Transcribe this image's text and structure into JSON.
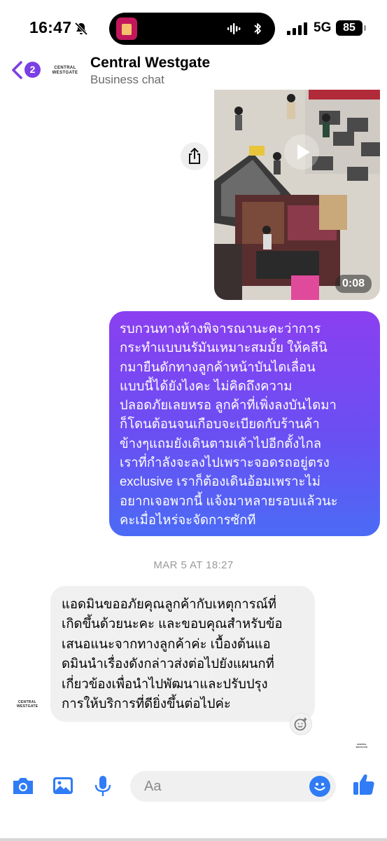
{
  "status": {
    "time": "16:47",
    "network": "5G",
    "battery": "85"
  },
  "header": {
    "back_count": "2",
    "logo_line1": "CENTRAL",
    "logo_line2": "WESTGATE",
    "title": "Central Westgate",
    "subtitle": "Business chat"
  },
  "video": {
    "duration": "0:08"
  },
  "messages": {
    "outgoing_lines": [
      "รบกวนทางห้างพิจารณานะคะว่าการ",
      "กระทำแบบนรัมันเหมาะสมมั้ย ให้คลีนิ",
      "กมายืนดักทางลูกค้าหน้าบันไดเลื่อน",
      "แบบนี้ได้ยังไงคะ ไม่คิดถึงความ",
      "ปลอดภัยเลยหรอ ลูกค้าที่เพิ่งลงบันไดมา",
      "ก็โดนต้อนจนเกือบจะเบียดกับร้านค้า",
      "ข้างๆแถมยังเดินตามเค้าไปอีกตั้งไกล",
      "เราที่กำลังจะลงไปเพราะจอดรถอยู่ตรง",
      "exclusive เราก็ต้องเดินอ้อมเพราะไม่",
      "อยากเจอพวกนี้ แจ้งมาหลายรอบแล้วนะ",
      "คะเมื่อไหร่จะจัดการซักที"
    ],
    "timestamp": "MAR 5 AT 18:27",
    "incoming_lines": [
      "แอดมินขออภัยคุณลูกค้ากับเหตุการณ์ที่",
      "เกิดขึ้นด้วยนะคะ และขอบคุณสำหรับข้อ",
      "เสนอแนะจากทางลูกค้าค่ะ เบื้องต้นแอ",
      "ดมินนำเรื่องดังกล่าวส่งต่อไปยังแผนกที่",
      "เกี่ยวข้องเพื่อนำไปพัฒนาและปรับปรุง",
      "การให้บริการที่ดียิ่งขึ้นต่อไปค่ะ"
    ]
  },
  "composer": {
    "placeholder": "Aa"
  },
  "colors": {
    "accent": "#7b3fe4",
    "messenger_blue": "#2f7cf6",
    "bubble_top": "#8a3ff0",
    "bubble_bottom": "#4b6bf5"
  },
  "icons": [
    "bell-slash-icon",
    "audio-wave-icon",
    "bluetooth-icon",
    "signal-icon",
    "back-chevron-icon",
    "share-icon",
    "play-icon",
    "add-reaction-icon",
    "camera-icon",
    "image-icon",
    "microphone-icon",
    "emoji-icon",
    "thumbs-up-icon"
  ]
}
